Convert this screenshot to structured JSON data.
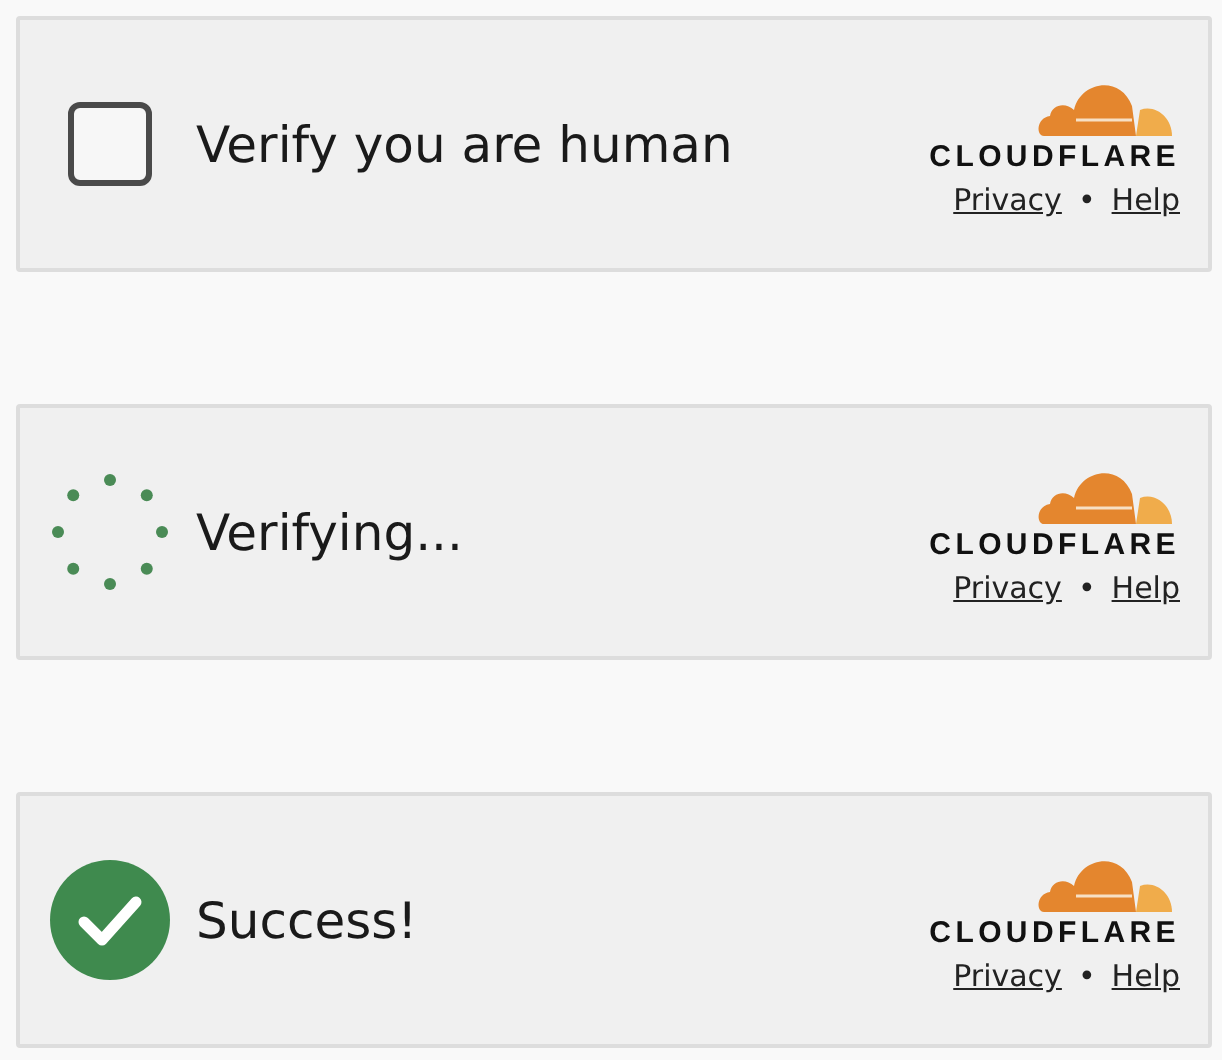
{
  "widgets": [
    {
      "kind": "checkbox",
      "checked": false,
      "label": "Verify you are human",
      "brand": "CLOUDFLARE",
      "links": [
        "Privacy",
        "Help"
      ],
      "separator": "•"
    },
    {
      "kind": "spinner",
      "label": "Verifying...",
      "brand": "CLOUDFLARE",
      "links": [
        "Privacy",
        "Help"
      ],
      "separator": "•"
    },
    {
      "kind": "success",
      "label": "Success!",
      "brand": "CLOUDFLARE",
      "links": [
        "Privacy",
        "Help"
      ],
      "separator": "•"
    }
  ]
}
